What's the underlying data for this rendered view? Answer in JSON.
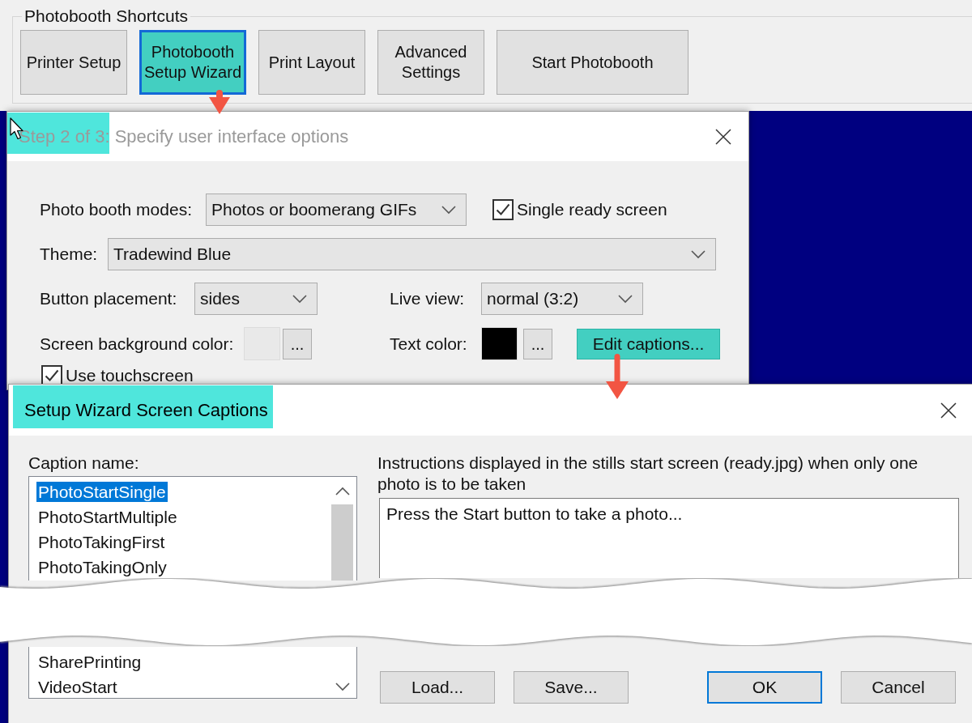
{
  "shortcuts": {
    "title": "Photobooth Shortcuts",
    "buttons": [
      {
        "label": "Printer Setup",
        "highlighted": false,
        "focused": false
      },
      {
        "label": "Photobooth Setup Wizard",
        "highlighted": true,
        "focused": true
      },
      {
        "label": "Print Layout",
        "highlighted": false,
        "focused": false
      },
      {
        "label": "Advanced Settings",
        "highlighted": false,
        "focused": false
      },
      {
        "label": "Start Photobooth",
        "highlighted": false,
        "focused": false
      }
    ]
  },
  "wizard_dialog": {
    "active": false,
    "title_parts": [
      {
        "text": "Step 2 of 3",
        "highlighted": true
      },
      {
        "text": ": Specify user interface options",
        "highlighted": false
      }
    ],
    "photo_booth_modes": {
      "label": "Photo booth modes:",
      "value": "Photos or boomerang GIFs"
    },
    "single_ready_screen": {
      "label": "Single ready screen",
      "checked": true
    },
    "theme": {
      "label": "Theme:",
      "value": "Tradewind Blue"
    },
    "button_placement": {
      "label": "Button placement:",
      "value": "sides"
    },
    "live_view": {
      "label": "Live view:",
      "value": "normal (3:2)"
    },
    "screen_background_color": {
      "label": "Screen background color:",
      "color": "#e9e9e9",
      "button": "..."
    },
    "text_color": {
      "label": "Text color:",
      "color": "#000000",
      "button": "..."
    },
    "edit_captions_button": {
      "label": "Edit captions...",
      "highlighted": true
    },
    "use_touchscreen": {
      "label": "Use touchscreen",
      "checked": true
    }
  },
  "captions_dialog": {
    "active": true,
    "title_parts": [
      {
        "text": "Setup Wizard Screen Captions",
        "highlighted": true
      }
    ],
    "caption_name_label": "Caption name:",
    "caption_list": {
      "items_above_tear": [
        {
          "text": "PhotoStartSingle",
          "selected": true
        },
        {
          "text": "PhotoStartMultiple",
          "selected": false
        },
        {
          "text": "PhotoTakingFirst",
          "selected": false
        },
        {
          "text": "PhotoTakingOnly",
          "selected": false
        }
      ],
      "items_below_tear": [
        {
          "text": "SharePrinting",
          "selected": false
        },
        {
          "text": "VideoStart",
          "selected": false
        }
      ]
    },
    "description": "Instructions displayed in the stills start screen (ready.jpg) when only one photo is to be taken",
    "caption_text": "Press the Start button to take a photo...",
    "file_buttons": [
      {
        "label": "Load...",
        "default": false
      },
      {
        "label": "Save...",
        "default": false
      }
    ],
    "dialog_buttons": [
      {
        "label": "OK",
        "default": true
      },
      {
        "label": "Cancel",
        "default": false
      }
    ]
  }
}
